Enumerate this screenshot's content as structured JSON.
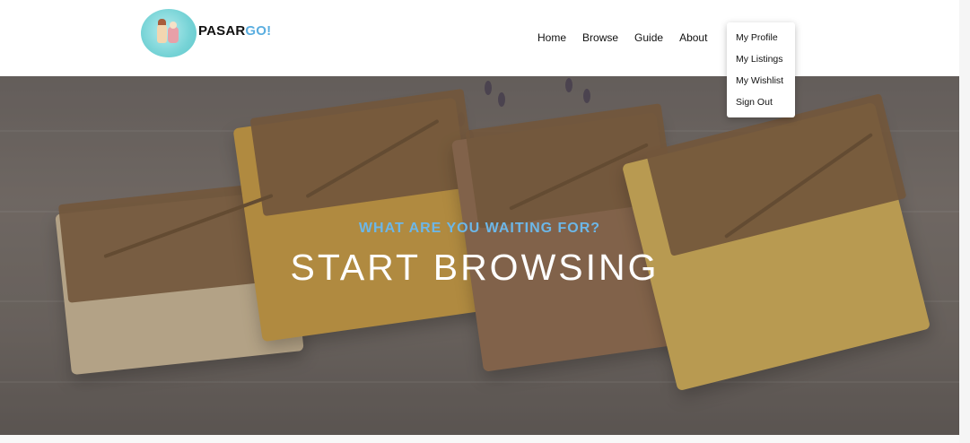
{
  "brand": {
    "name_part1": "PASAR",
    "name_part2": "GO!",
    "accent_color": "#5aaee0",
    "logo_icon": "pasargo-mascot-logo"
  },
  "nav": {
    "items": [
      {
        "label": "Home"
      },
      {
        "label": "Browse"
      },
      {
        "label": "Guide"
      },
      {
        "label": "About"
      }
    ]
  },
  "account_menu": {
    "items": [
      {
        "label": "My Profile"
      },
      {
        "label": "My Listings"
      },
      {
        "label": "My Wishlist"
      },
      {
        "label": "Sign Out"
      }
    ]
  },
  "hero": {
    "subtitle": "WHAT ARE YOU WAITING FOR?",
    "title": "START BROWSING",
    "subtitle_color": "#6cb7e8",
    "image": "handmade-soap-bars-photo"
  }
}
